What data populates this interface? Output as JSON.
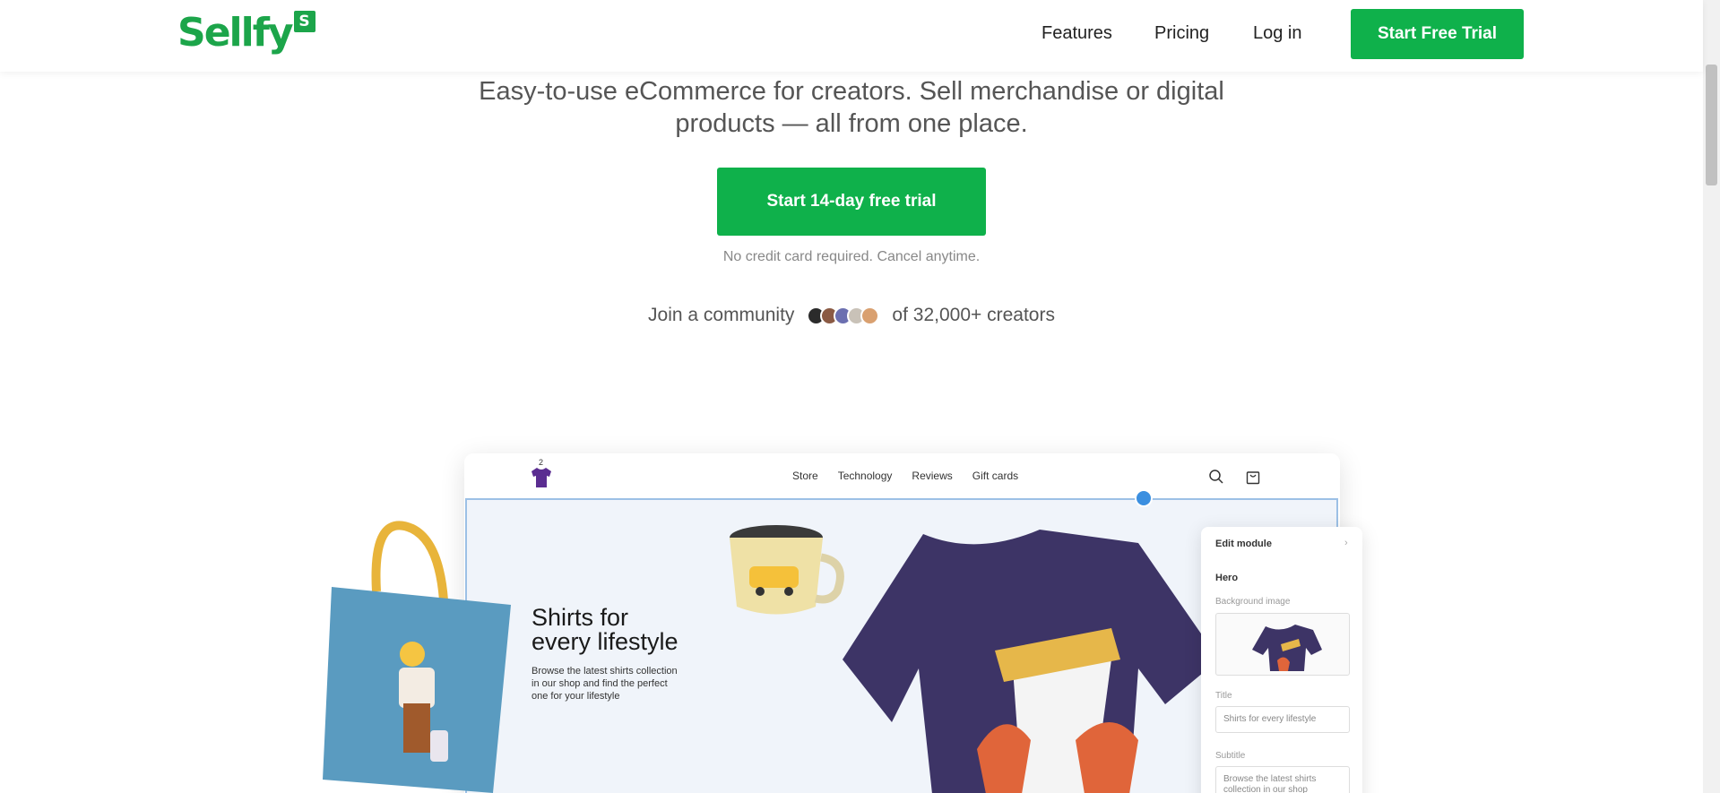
{
  "header": {
    "logo_text": "Sellfy",
    "logo_badge": "S",
    "nav": [
      "Features",
      "Pricing",
      "Log in"
    ],
    "cta": "Start Free Trial"
  },
  "hero": {
    "tagline": "Easy-to-use eCommerce for creators. Sell merchandise or digital products — all from one place.",
    "cta": "Start 14-day free trial",
    "note": "No credit card required. Cancel anytime.",
    "community_prefix": "Join a community",
    "community_suffix": "of 32,000+ creators"
  },
  "mockup": {
    "nav_links": [
      "Store",
      "Technology",
      "Reviews",
      "Gift cards"
    ],
    "cart_count": "2",
    "hero_title_line1": "Shirts for",
    "hero_title_line2": "every lifestyle",
    "hero_sub": "Browse the latest shirts collection in our shop and find the perfect one for your lifestyle"
  },
  "edit_panel": {
    "title": "Edit module",
    "section": "Hero",
    "bg_label": "Background image",
    "title_label": "Title",
    "title_value": "Shirts for every lifestyle",
    "subtitle_label": "Subtitle",
    "subtitle_value": "Browse the latest shirts collection in our shop"
  },
  "colors": {
    "brand_green": "#0fb14b",
    "logo_green": "#1ca54a",
    "shirt_purple": "#3d3466",
    "tote_blue": "#5a9bc0"
  }
}
